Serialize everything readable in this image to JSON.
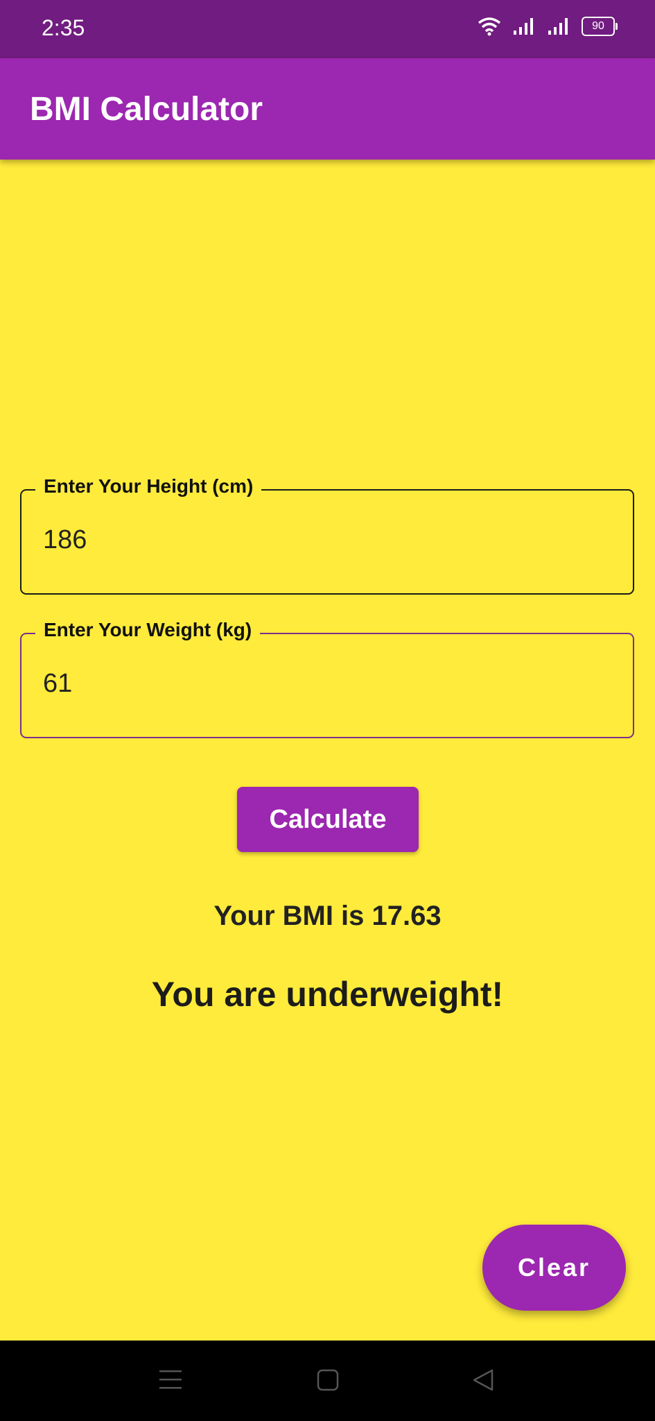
{
  "status_bar": {
    "time": "2:35",
    "battery_level": "90",
    "icons": [
      "wifi-icon",
      "signal-icon",
      "signal-icon",
      "battery-icon"
    ]
  },
  "app_bar": {
    "title": "BMI Calculator"
  },
  "form": {
    "height": {
      "label": "Enter Your Height (cm)",
      "value": "186"
    },
    "weight": {
      "label": "Enter Your Weight (kg)",
      "value": "61"
    },
    "calculate_label": "Calculate"
  },
  "result": {
    "bmi_text": "Your BMI is 17.63",
    "verdict": "You are underweight!"
  },
  "fab": {
    "clear_label": "Clear"
  },
  "nav": {
    "icons": [
      "menu-icon",
      "home-icon",
      "back-icon"
    ]
  },
  "colors": {
    "primary": "#9c27b0",
    "primary_dark": "#711c80",
    "background": "#ffeb3b"
  }
}
